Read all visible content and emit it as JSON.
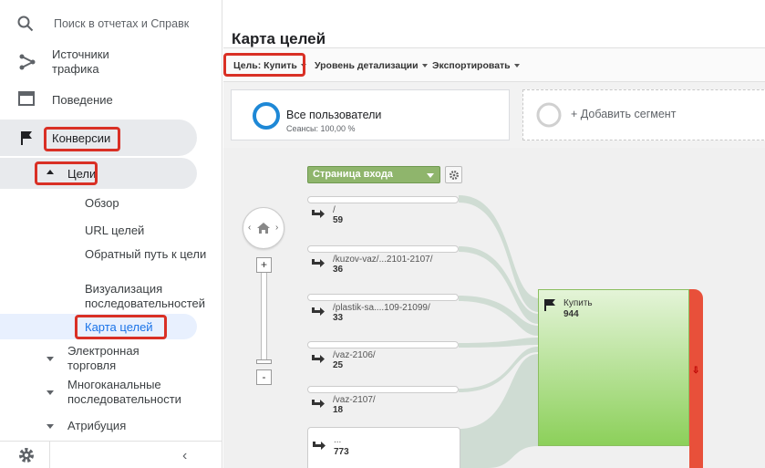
{
  "search": {
    "placeholder": "Поиск в отчетах и Справк"
  },
  "sidebar": {
    "traffic_sources": "Источники трафика",
    "behavior": "Поведение",
    "conversions": "Конверсии",
    "goals": "Цели",
    "goals_children": [
      "Обзор",
      "URL целей",
      "Обратный путь к цели",
      "Визуализация последовательностей",
      "Карта целей"
    ],
    "ecommerce": "Электронная торговля",
    "multichannel": "Многоканальные последовательности",
    "attribution": "Атрибуция"
  },
  "main": {
    "title": "Карта целей",
    "toolbar": {
      "goal": "Цель: Купить",
      "detail_level": "Уровень детализации",
      "export": "Экспортировать"
    },
    "segments": {
      "all_users_title": "Все пользователи",
      "all_users_sub": "Сеансы: 100,00 %",
      "add_segment": "+ Добавить сегмент"
    },
    "entry_dropdown": "Страница входа",
    "nodes": [
      {
        "path": "/",
        "count": "59"
      },
      {
        "path": "/kuzov-vaz/...2101-2107/",
        "count": "36"
      },
      {
        "path": "/plastik-sa....109-21099/",
        "count": "33"
      },
      {
        "path": "/vaz-2106/",
        "count": "25"
      },
      {
        "path": "/vaz-2107/",
        "count": "18"
      },
      {
        "path": "...",
        "count": "773"
      }
    ],
    "goal_node": {
      "label": "Купить",
      "count": "944"
    },
    "zoom": {
      "plus": "+",
      "minus": "-"
    }
  },
  "colors": {
    "highlight_red": "#d93025",
    "goal_green": "#8cd05a",
    "exit_red": "#e8503a",
    "entry_green": "#8fb56c",
    "active_blue": "#1a73e8"
  }
}
